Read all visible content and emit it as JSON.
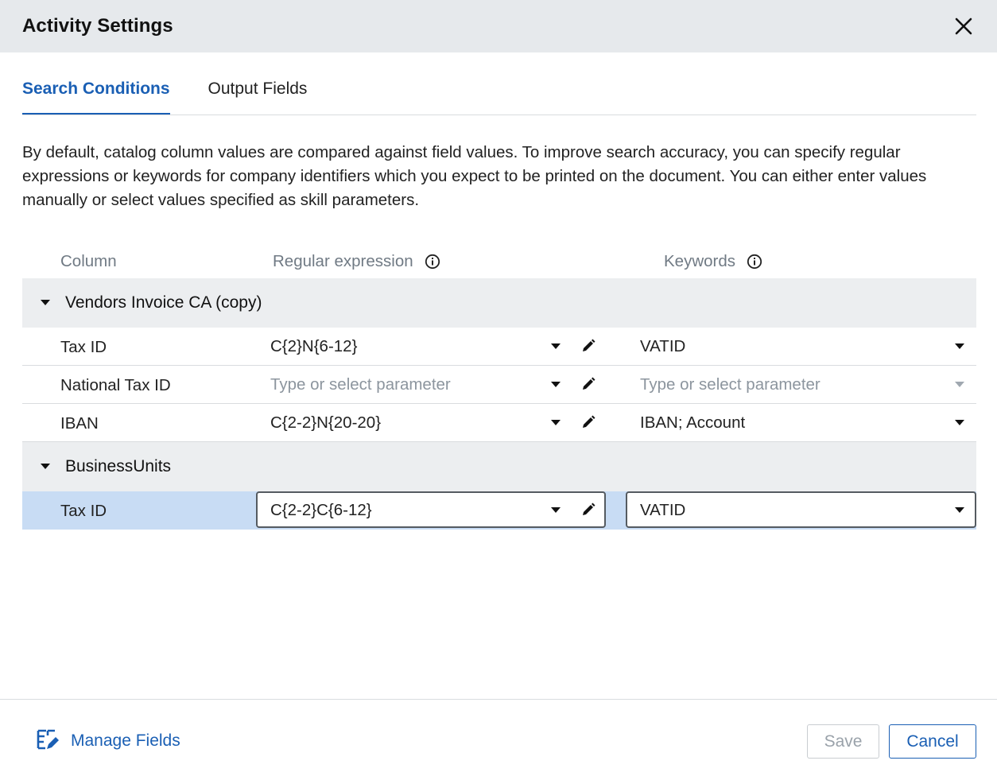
{
  "header": {
    "title": "Activity Settings"
  },
  "tabs": [
    {
      "label": "Search Conditions",
      "active": true
    },
    {
      "label": "Output Fields",
      "active": false
    }
  ],
  "description": "By default, catalog column values are compared against field values. To improve search accuracy, you can specify regular expressions or keywords for company identifiers which you expect to be printed on the document. You can either enter values manually or select values specified as skill parameters.",
  "table": {
    "headers": {
      "column": "Column",
      "regex": "Regular expression",
      "keywords": "Keywords"
    },
    "groups": [
      {
        "label": "Vendors Invoice CA (copy)",
        "rows": [
          {
            "name": "Tax ID",
            "regex": "C{2}N{6-12}",
            "keywords": "VATID"
          },
          {
            "name": "National Tax ID",
            "regex_placeholder": "Type or select parameter",
            "keywords_placeholder": "Type or select parameter"
          },
          {
            "name": "IBAN",
            "regex": "C{2-2}N{20-20}",
            "keywords": "IBAN; Account"
          }
        ]
      },
      {
        "label": "BusinessUnits",
        "rows": [
          {
            "name": "Tax ID",
            "regex": "C{2-2}C{6-12}",
            "keywords": "VATID",
            "selected": true
          }
        ]
      }
    ]
  },
  "footer": {
    "manage_fields": "Manage Fields",
    "save": "Save",
    "cancel": "Cancel"
  },
  "colors": {
    "accent": "#1a5fb4",
    "header_bg": "#e6e9ec",
    "group_bg": "#eceef0",
    "selected_row_bg": "#c8dcf4"
  },
  "icons": {
    "close": "close-icon",
    "info": "info-icon",
    "expand": "caret-down-icon",
    "dropdown": "chevron-down-icon",
    "edit": "pencil-icon",
    "manage_fields": "manage-fields-icon"
  }
}
